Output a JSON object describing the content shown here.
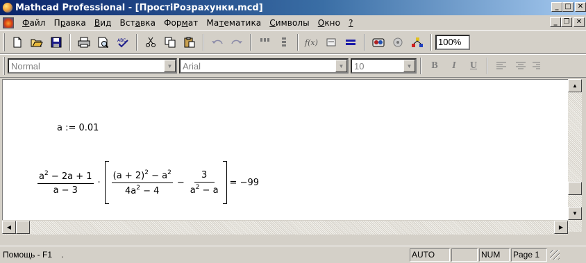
{
  "window": {
    "title": "Mathcad Professional - [ПростіРозрахунки.mcd]",
    "controls": {
      "minimize": "_",
      "restore": "□",
      "close": "✕"
    },
    "doc_controls": {
      "minimize": "_",
      "restore": "❐",
      "close": "✕"
    }
  },
  "menu": {
    "items": [
      {
        "pre": "",
        "u": "Ф",
        "post": "айл"
      },
      {
        "pre": "П",
        "u": "р",
        "post": "авка"
      },
      {
        "pre": "",
        "u": "В",
        "post": "ид"
      },
      {
        "pre": "Вст",
        "u": "а",
        "post": "вка"
      },
      {
        "pre": "Фор",
        "u": "м",
        "post": "ат"
      },
      {
        "pre": "Ма",
        "u": "т",
        "post": "ематика"
      },
      {
        "pre": "",
        "u": "С",
        "post": "имволы"
      },
      {
        "pre": "",
        "u": "О",
        "post": "кно"
      },
      {
        "pre": "",
        "u": "?",
        "post": ""
      }
    ]
  },
  "toolbar": {
    "icons": [
      "new-icon",
      "open-icon",
      "save-icon",
      "print-icon",
      "preview-icon",
      "spellcheck-icon",
      "cut-icon",
      "copy-icon",
      "paste-icon",
      "undo-icon",
      "redo-icon",
      "align-h-icon",
      "align-v-icon",
      "function-icon",
      "units-icon",
      "calculate-icon",
      "resource-icon",
      "component-icon",
      "wizard-icon"
    ],
    "zoom": "100%"
  },
  "format": {
    "style": "Normal",
    "font": "Arial",
    "size": "10",
    "bold": "B",
    "italic": "I",
    "underline": "U"
  },
  "worksheet": {
    "assignment": "a := 0.01",
    "result": "= −99"
  },
  "status": {
    "help": "Помощь - F1",
    "dot": ".",
    "mode": "AUTO",
    "blank": "",
    "num": "NUM",
    "page": "Page 1"
  }
}
